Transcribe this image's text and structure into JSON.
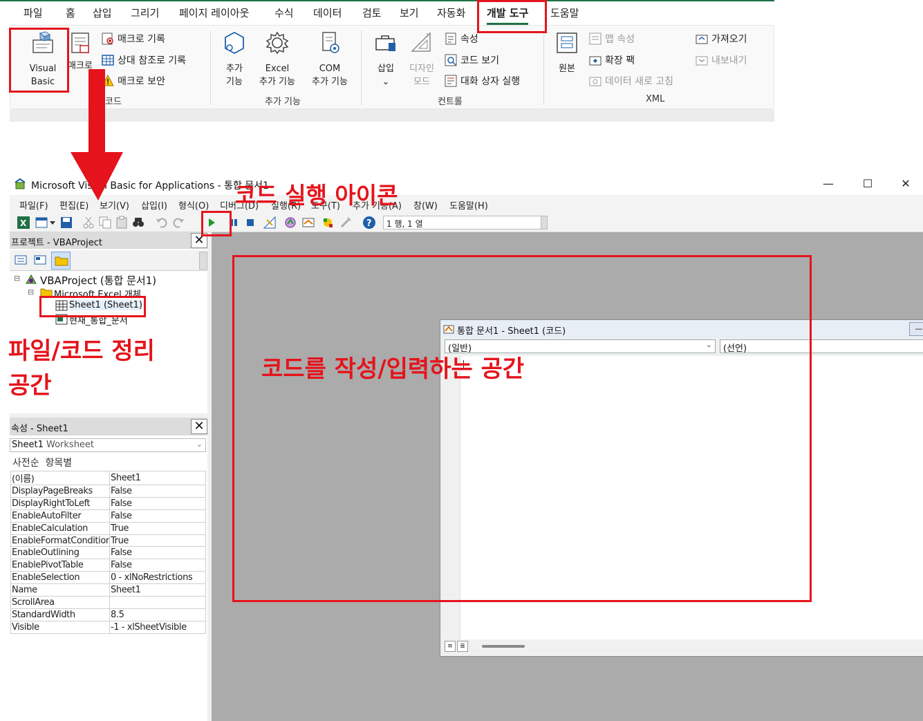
{
  "ribbon": {
    "tabs": [
      "파일",
      "홈",
      "삽입",
      "그리기",
      "페이지 레이아웃",
      "수식",
      "데이터",
      "검토",
      "보기",
      "자동화",
      "개발 도구",
      "도움말"
    ],
    "active_tab": "개발 도구",
    "code_group": {
      "visual_basic_line1": "Visual",
      "visual_basic_line2": "Basic",
      "macros": "매크로",
      "record_macro": "매크로 기록",
      "relative_refs": "상대 참조로 기록",
      "macro_security": "매크로 보안",
      "label": "코드"
    },
    "addins_group": {
      "addins_line1": "추가",
      "addins_line2": "기능",
      "excel_addins_line1": "Excel",
      "excel_addins_line2": "추가 기능",
      "com_addins_line1": "COM",
      "com_addins_line2": "추가 기능",
      "label": "추가 기능"
    },
    "controls_group": {
      "insert": "삽입",
      "insert_arrow": "⌄",
      "design_mode_line1": "디자인",
      "design_mode_line2": "모드",
      "properties": "속성",
      "view_code": "코드 보기",
      "run_dialog": "대화 상자 실행",
      "label": "컨트롤"
    },
    "xml_group": {
      "source": "원본",
      "map_properties": "맵 속성",
      "expansion_packs": "확장 팩",
      "refresh_data": "데이터 새로 고침",
      "import": "가져오기",
      "export": "내보내기",
      "label": "XML"
    }
  },
  "vbe": {
    "title": "Microsoft Visual Basic for Applications - 통합 문서1",
    "window_controls": {
      "minimize": "—",
      "maximize": "☐",
      "close": "✕"
    },
    "menu": [
      "파일(F)",
      "편집(E)",
      "보기(V)",
      "삽입(I)",
      "형식(O)",
      "디버그(D)",
      "실행(R)",
      "도구(T)",
      "추가 기능(A)",
      "창(W)",
      "도움말(H)"
    ],
    "cursor_position": "1 행, 1 열",
    "project": {
      "header": "프로젝트 - VBAProject",
      "root": "VBAProject (통합 문서1)",
      "folder": "Microsoft Excel 개체",
      "sheet": "Sheet1 (Sheet1)",
      "workbook": "현재_통합_문서"
    },
    "properties": {
      "header": "속성 - Sheet1",
      "object_name": "Sheet1",
      "object_type": "Worksheet",
      "tab_alpha": "사전순",
      "tab_category": "항목별",
      "rows": [
        {
          "k": "(이름)",
          "v": "Sheet1"
        },
        {
          "k": "DisplayPageBreaks",
          "v": "False"
        },
        {
          "k": "DisplayRightToLeft",
          "v": "False"
        },
        {
          "k": "EnableAutoFilter",
          "v": "False"
        },
        {
          "k": "EnableCalculation",
          "v": "True"
        },
        {
          "k": "EnableFormatConditionsCalculation",
          "v": "True"
        },
        {
          "k": "EnableOutlining",
          "v": "False"
        },
        {
          "k": "EnablePivotTable",
          "v": "False"
        },
        {
          "k": "EnableSelection",
          "v": "0 - xlNoRestrictions"
        },
        {
          "k": "Name",
          "v": "Sheet1"
        },
        {
          "k": "ScrollArea",
          "v": ""
        },
        {
          "k": "StandardWidth",
          "v": "8.5"
        },
        {
          "k": "Visible",
          "v": "-1 - xlSheetVisible"
        }
      ]
    },
    "code_window": {
      "title": "통합 문서1 - Sheet1 (코드)",
      "object_combo": "(일반)",
      "proc_combo": "(선언)"
    }
  },
  "annotations": {
    "run_icon": "코드 실행 아이콘",
    "file_area_line1": "파일/코드 정리",
    "file_area_line2": "공간",
    "code_area": "코드를 작성/입력하는 공간"
  },
  "colors": {
    "annotation_red": "#e5131b",
    "excel_green": "#1e7145",
    "mdi_gray": "#ababab",
    "run_green": "#1a9a2a"
  }
}
